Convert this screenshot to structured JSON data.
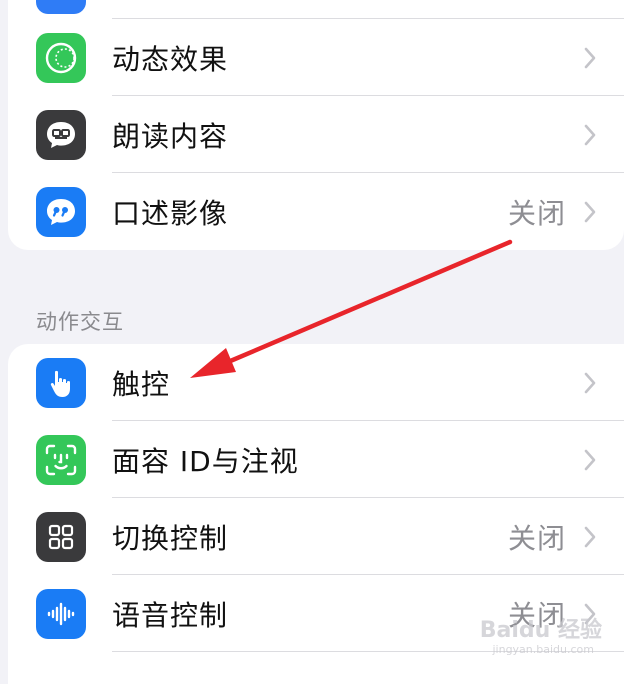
{
  "vision_group": {
    "items": [
      {
        "label": "",
        "value": "",
        "icon": "partial-blue-icon",
        "color": "#2f7cf6"
      },
      {
        "label": "动态效果",
        "value": "",
        "icon": "motion-circle-icon",
        "color": "#34c759"
      },
      {
        "label": "朗读内容",
        "value": "",
        "icon": "speech-bubble-icon",
        "color": "#3a3a3c"
      },
      {
        "label": "口述影像",
        "value": "关闭",
        "icon": "quote-bubble-icon",
        "color": "#1a7cf5"
      }
    ]
  },
  "interaction_group": {
    "header": "动作交互",
    "items": [
      {
        "label": "触控",
        "value": "",
        "icon": "hand-pointer-icon",
        "color": "#1a7cf5"
      },
      {
        "label": "面容 ID与注视",
        "value": "",
        "icon": "face-id-icon",
        "color": "#34c759"
      },
      {
        "label": "切换控制",
        "value": "关闭",
        "icon": "grid-squares-icon",
        "color": "#3a3a3c"
      },
      {
        "label": "语音控制",
        "value": "关闭",
        "icon": "voice-wave-icon",
        "color": "#1a7cf5"
      }
    ]
  },
  "annotation": {
    "arrow_color": "#e8252b"
  },
  "watermark": {
    "text": "Baidu 经验",
    "sub": "jingyan.baidu.com"
  }
}
